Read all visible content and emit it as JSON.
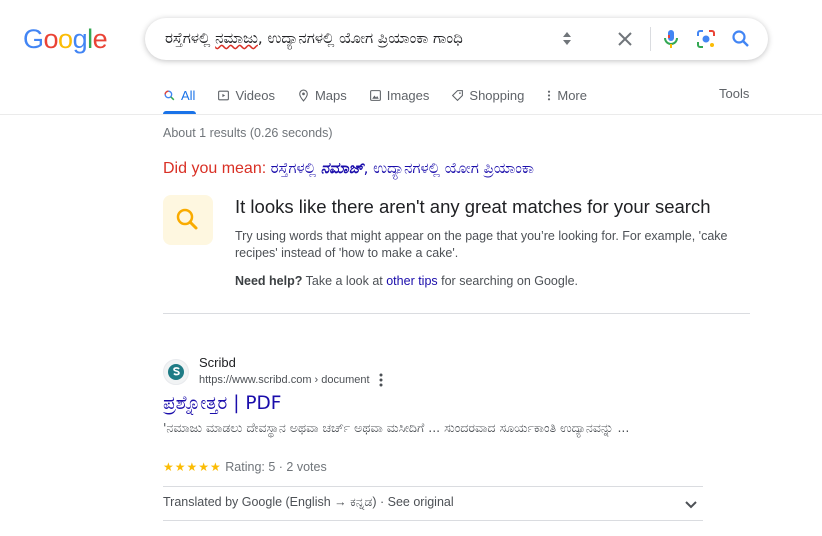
{
  "logo": {
    "letters": [
      "G",
      "o",
      "o",
      "g",
      "l",
      "e"
    ],
    "colors": [
      "#4285f4",
      "#ea4335",
      "#fbbc05",
      "#4285f4",
      "#34a853",
      "#ea4335"
    ]
  },
  "search": {
    "query_before": "ರಸ್ತೆಗಳಲ್ಲಿ ",
    "query_misspelled": "ನಮಾಜು",
    "query_after": ", ಉದ್ಯಾನಗಳಲ್ಲಿ ಯೋಗ ಪ್ರಿಯಾಂಕಾ ಗಾಂಧಿ"
  },
  "tabs": [
    {
      "label": "All",
      "icon": "search-icon",
      "active": true
    },
    {
      "label": "Videos",
      "icon": "video-icon"
    },
    {
      "label": "Maps",
      "icon": "map-pin-icon"
    },
    {
      "label": "Images",
      "icon": "image-icon"
    },
    {
      "label": "Shopping",
      "icon": "tag-icon"
    },
    {
      "label": "More",
      "icon": "more-vertical-icon"
    }
  ],
  "tools_label": "Tools",
  "stats": "About 1 results (0.26 seconds)",
  "did_you_mean": {
    "label": "Did you mean: ",
    "before": "ರಸ್ತೆಗಳಲ್ಲಿ ",
    "bold": "ನಮಾಜ್",
    "after": ", ಉದ್ಯಾನಗಳಲ್ಲಿ ಯೋಗ ಪ್ರಿಯಾಂಕಾ"
  },
  "no_results": {
    "title": "It looks like there aren't any great matches for your search",
    "description": "Try using words that might appear on the page that you’re looking for. For example, 'cake recipes' instead of 'how to make a cake'.",
    "help_bold": "Need help?",
    "help_before": " Take a look at ",
    "help_link": "other tips",
    "help_after": " for searching on Google."
  },
  "result": {
    "site_name": "Scribd",
    "url": "https://www.scribd.com › document",
    "title": "ಪ್ರಶ್ನೋತ್ತರ | PDF",
    "snippet": "'ನಮಾಜು ಮಾಡಲು ದೇವಸ್ಥಾನ ಅಥವಾ ಚರ್ಚ್ ಅಥವಾ ಮಸೀದಿಗೆ ... ಸುಂದರವಾದ ಸೂರ್ಯಕಾಂತಿ ಉದ್ಯಾನವನ್ನು ...",
    "stars": "★★★★★",
    "rating_text": "Rating: 5 · 2 votes",
    "rating_value": 5,
    "translated": "Translated by Google (English → ಕನ್ನಡ) · See original"
  }
}
